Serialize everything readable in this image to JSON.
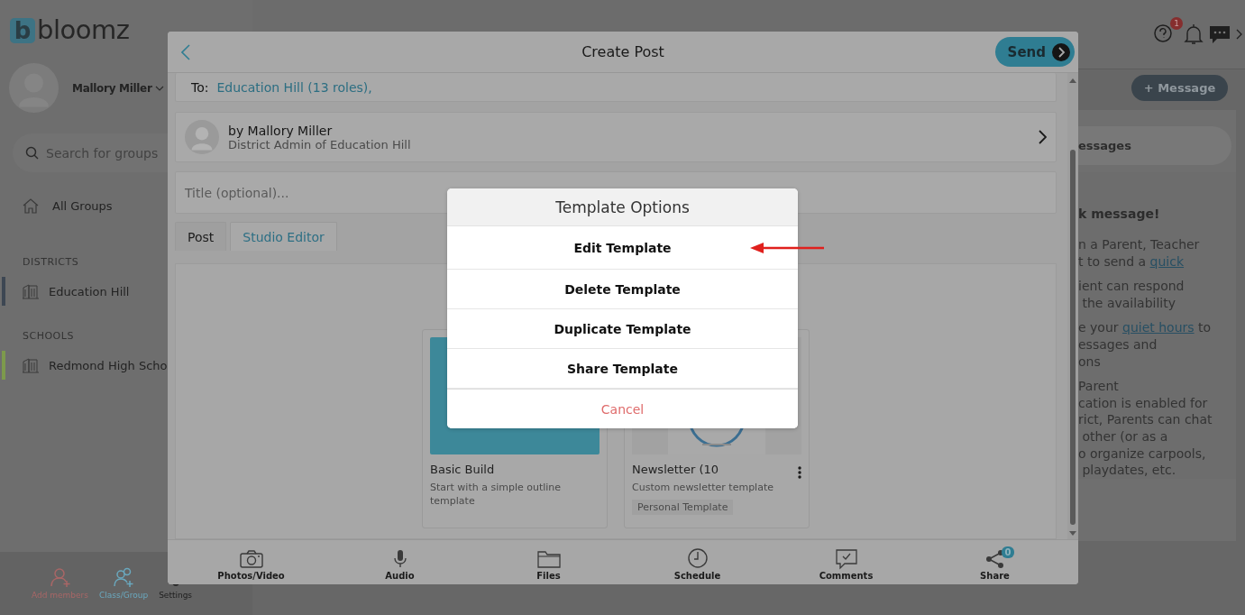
{
  "sidebar": {
    "logo": {
      "mark": "b",
      "name": "bloomz"
    },
    "user": {
      "name": "Mallory Miller"
    },
    "search": {
      "placeholder": "Search for groups"
    },
    "all_groups": "All Groups",
    "sections": [
      {
        "title": "DISTRICTS",
        "items": [
          {
            "label": "Education Hill",
            "color": "#3d4753"
          }
        ]
      },
      {
        "title": "SCHOOLS",
        "items": [
          {
            "label": "Redmond High Scho",
            "color": "#7d9a4c"
          }
        ]
      }
    ],
    "bottom_actions": [
      {
        "label": "Add members",
        "color": "#a86666",
        "kind": "add-person"
      },
      {
        "label": "Class/Group",
        "color": "#6aa8be",
        "kind": "group"
      },
      {
        "label": "Settings",
        "color": "#1e1e1e",
        "kind": "gear"
      }
    ]
  },
  "header": {
    "help_badge": "1",
    "message_button": "+ Message"
  },
  "right_panel": {
    "search_text": "essages",
    "heading": "k message!",
    "paragraphs": [
      [
        [
          {
            "text": "n a Parent, Teacher"
          }
        ],
        [
          {
            "text": "t to send a "
          },
          {
            "text": "quick",
            "link": true
          }
        ]
      ],
      [
        [
          {
            "text": "ient can respond"
          }
        ],
        [
          {
            "text": " the availability"
          }
        ]
      ],
      [
        [
          {
            "text": "e your "
          },
          {
            "text": "quiet hours",
            "link": true
          },
          {
            "text": " to"
          }
        ],
        [
          {
            "text": "essages and"
          }
        ],
        [
          {
            "text": "ons"
          }
        ]
      ],
      [
        [
          {
            "text": "Parent"
          }
        ],
        [
          {
            "text": "cation is enabled for"
          }
        ],
        [
          {
            "text": "rict, Parents can chat"
          }
        ],
        [
          {
            "text": " other (or as a"
          }
        ],
        [
          {
            "text": "o organize carpools,"
          }
        ],
        [
          {
            "text": " playdates, etc."
          }
        ]
      ]
    ]
  },
  "modal": {
    "title": "Create Post",
    "send": "Send",
    "to_label": "To:",
    "to_value": "Education Hill (13 roles),",
    "author": {
      "name": "by Mallory Miller",
      "role": "District Admin of Education Hill"
    },
    "title_field": {
      "placeholder": "Title (optional)..."
    },
    "tabs": [
      {
        "label": "Post",
        "selected": false
      },
      {
        "label": "Studio Editor",
        "selected": true
      }
    ],
    "templates": [
      {
        "name": "Basic Build",
        "description": "Start with a simple outline template",
        "kind": "solid",
        "menu": false
      },
      {
        "name": "Newsletter (10",
        "description": "Custom newsletter template",
        "tag": "Personal Template",
        "kind": "picture",
        "menu": true
      }
    ],
    "toolbar": [
      {
        "label": "Photos/Video",
        "kind": "camera"
      },
      {
        "label": "Audio",
        "kind": "mic"
      },
      {
        "label": "Files",
        "kind": "folder"
      },
      {
        "label": "Schedule",
        "kind": "clock"
      },
      {
        "label": "Comments",
        "kind": "comment"
      },
      {
        "label": "Share",
        "kind": "share",
        "badge": "0"
      }
    ]
  },
  "template_options": {
    "title": "Template Options",
    "items": [
      {
        "label": "Edit Template",
        "kind": "action"
      },
      {
        "label": "Delete Template",
        "kind": "action"
      },
      {
        "label": "Duplicate Template",
        "kind": "action"
      },
      {
        "label": "Share Template",
        "kind": "action"
      },
      {
        "label": "Cancel",
        "kind": "cancel"
      }
    ]
  }
}
